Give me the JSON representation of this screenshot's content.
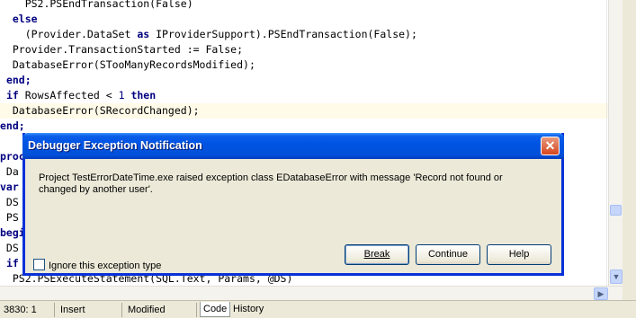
{
  "editor": {
    "lines": [
      {
        "segments": [
          {
            "t": "    PS2.PSEndTransaction(False)",
            "k": false
          }
        ],
        "current": false
      },
      {
        "segments": [
          {
            "t": "  ",
            "k": false
          },
          {
            "t": "else",
            "k": true
          }
        ],
        "current": false
      },
      {
        "segments": [
          {
            "t": "    (Provider.DataSet ",
            "k": false
          },
          {
            "t": "as",
            "k": true
          },
          {
            "t": " IProviderSupport).PSEndTransaction(False);",
            "k": false
          }
        ],
        "current": false
      },
      {
        "segments": [
          {
            "t": "  Provider.TransactionStarted := False;",
            "k": false
          }
        ],
        "current": false
      },
      {
        "segments": [
          {
            "t": "  DatabaseError(STooManyRecordsModified);",
            "k": false
          }
        ],
        "current": false
      },
      {
        "segments": [
          {
            "t": " ",
            "k": false
          },
          {
            "t": "end;",
            "k": true
          }
        ],
        "current": false
      },
      {
        "segments": [
          {
            "t": " ",
            "k": false
          },
          {
            "t": "if",
            "k": true
          },
          {
            "t": " RowsAffected < ",
            "k": false
          },
          {
            "t": "1",
            "n": true
          },
          {
            "t": " ",
            "k": false
          },
          {
            "t": "then",
            "k": true
          }
        ],
        "current": false
      },
      {
        "segments": [
          {
            "t": "  DatabaseError(SRecordChanged);",
            "k": false
          }
        ],
        "current": true
      },
      {
        "segments": [
          {
            "t": "end;",
            "k": true
          }
        ],
        "current": false
      },
      {
        "segments": [
          {
            "t": "",
            "k": false
          }
        ],
        "current": false
      },
      {
        "segments": [
          {
            "t": "proc",
            "k": true
          }
        ],
        "current": false
      },
      {
        "segments": [
          {
            "t": " Da",
            "k": false
          }
        ],
        "current": false
      },
      {
        "segments": [
          {
            "t": "var",
            "k": true
          }
        ],
        "current": false
      },
      {
        "segments": [
          {
            "t": " DS",
            "k": false
          }
        ],
        "current": false
      },
      {
        "segments": [
          {
            "t": " PS",
            "k": false
          }
        ],
        "current": false
      },
      {
        "segments": [
          {
            "t": "begi",
            "k": true
          }
        ],
        "current": false
      },
      {
        "segments": [
          {
            "t": " DS",
            "k": false
          }
        ],
        "current": false
      },
      {
        "segments": [
          {
            "t": " ",
            "k": false
          },
          {
            "t": "if",
            "k": true
          }
        ],
        "current": false
      },
      {
        "segments": [
          {
            "t": "  PS2.PSExecuteStatement(SQL.Text, Params, @DS)",
            "k": false
          }
        ],
        "current": false
      }
    ]
  },
  "dialog": {
    "title": "Debugger Exception Notification",
    "message": "Project TestErrorDateTime.exe raised exception class EDatabaseError with message 'Record not found or changed by another user'.",
    "checkbox_label": "Ignore this exception type",
    "break_label": "Break",
    "continue_label": "Continue",
    "help_label": "Help",
    "close_glyph": "✕"
  },
  "statusbar": {
    "position": "3830:  1",
    "mode": "Insert",
    "state": "Modified",
    "tab_code": "Code",
    "tab_history": "History"
  },
  "icons": {
    "scroll_down": "▼",
    "scroll_right": "▶"
  },
  "colors": {
    "title_bar": "#0054e3",
    "keyword": "#000080",
    "current_line": "#fffbe8"
  }
}
